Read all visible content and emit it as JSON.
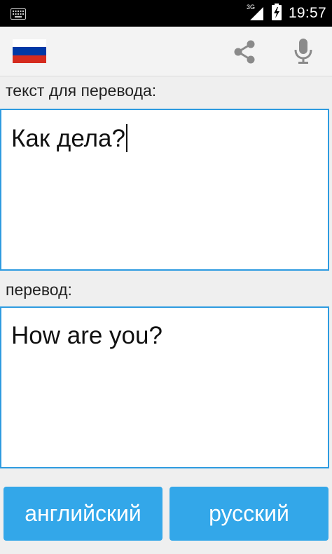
{
  "status_bar": {
    "network": "3G",
    "time": "19:57"
  },
  "action_bar": {
    "flag_colors": [
      "#ffffff",
      "#0039a6",
      "#d52b1e"
    ],
    "icons": [
      "keyboard-icon",
      "share-icon",
      "mic-icon"
    ]
  },
  "source": {
    "label": "текст для перевода:",
    "text": "Как дела?"
  },
  "translation": {
    "label": "перевод:",
    "text": "How are you?"
  },
  "buttons": {
    "from_language": "английский",
    "to_language": "русский"
  },
  "colors": {
    "accent": "#2e9be0",
    "button": "#33a7e9"
  }
}
